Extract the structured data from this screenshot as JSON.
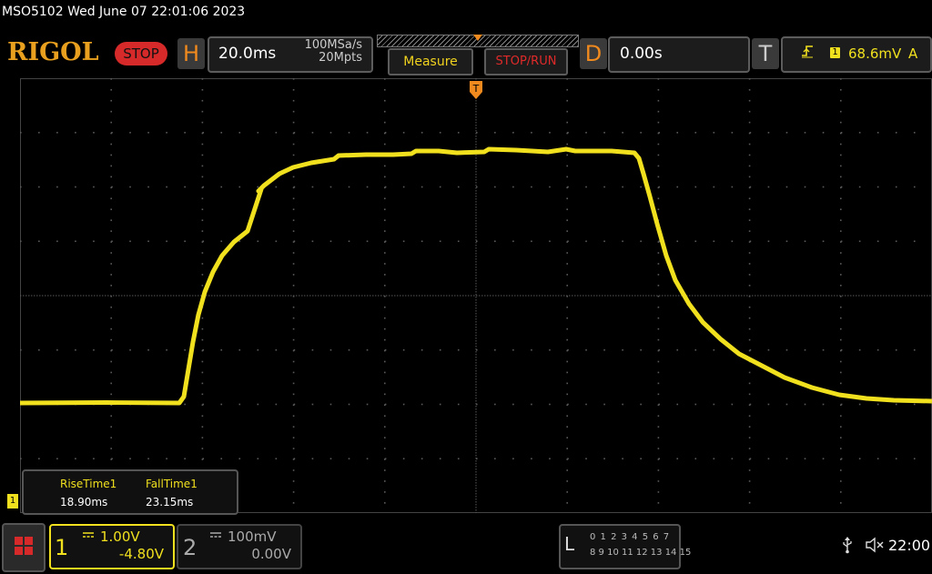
{
  "status": {
    "title": "MSO5102  Wed June 07 22:01:06 2023"
  },
  "brand": {
    "logo": "RIGOL",
    "run_state": "STOP"
  },
  "horizontal": {
    "letter": "H",
    "time_base": "20.0ms",
    "sample_rate": "100MSa/s",
    "memory_depth": "20Mpts"
  },
  "buttons": {
    "measure": "Measure",
    "stop_run": "STOP/RUN"
  },
  "delay": {
    "letter": "D",
    "value": "0.00s"
  },
  "trigger": {
    "letter": "T",
    "edge_icon": "rising-edge-icon",
    "source": "1",
    "level": "68.6mV",
    "mode": "A",
    "marker": "T"
  },
  "measurements": [
    {
      "label": "RiseTime1",
      "value": "18.90ms"
    },
    {
      "label": "FallTime1",
      "value": "23.15ms"
    }
  ],
  "channel1": {
    "number": "1",
    "scale": "1.00V",
    "offset": "-4.80V",
    "color": "#f0e01e",
    "level_marker": "1"
  },
  "channel2": {
    "number": "2",
    "scale": "100mV",
    "offset": "0.00V"
  },
  "logic": {
    "letter": "L",
    "row1": "0 1 2 3  4 5 6 7",
    "row2": "8 9 10 11 12 13 14 15"
  },
  "system": {
    "clock": "22:00",
    "usb_icon": "usb-icon",
    "sound_icon": "sound-muted-icon"
  },
  "colors": {
    "accent_orange": "#f08a1e",
    "stop_red": "#d62a2a",
    "trace_yellow": "#f0e01e"
  }
}
